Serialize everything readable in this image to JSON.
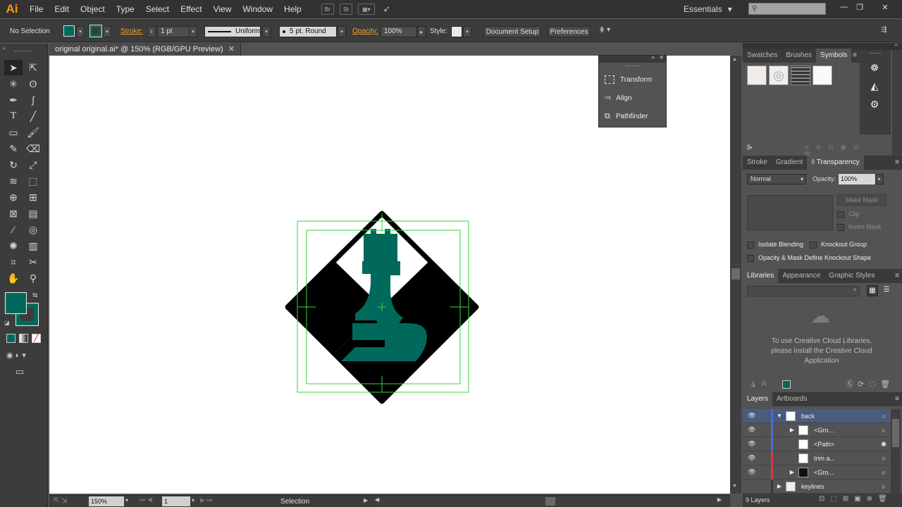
{
  "app": {
    "logo": "Ai",
    "brand_color": "#ff9a00"
  },
  "menu": [
    "File",
    "Edit",
    "Object",
    "Type",
    "Select",
    "Effect",
    "View",
    "Window",
    "Help"
  ],
  "menubar_extras": {
    "bridge": "Br",
    "stock": "St"
  },
  "workspace": "Essentials",
  "search": {
    "placeholder": ""
  },
  "control_bar": {
    "selection": "No Selection",
    "stroke_label": "Stroke:",
    "stroke_weight": "1 pt",
    "profile": "Uniform",
    "brush": "5 pt. Round",
    "opacity_label": "Opacity:",
    "opacity": "100%",
    "style_label": "Style:",
    "doc_setup": "Document Setup",
    "preferences": "Preferences"
  },
  "document": {
    "tab_title": "original original.ai* @ 150% (RGB/GPU Preview)",
    "zoom": "150%",
    "artboard": "1",
    "status": "Selection",
    "fill_color": "#00695c"
  },
  "float_panel": [
    {
      "label": "Transform",
      "icon": "transform-icon"
    },
    {
      "label": "Align",
      "icon": "align-icon"
    },
    {
      "label": "Pathfinder",
      "icon": "pathfinder-icon"
    }
  ],
  "symbols_panel": {
    "tabs": [
      "Swatches",
      "Brushes",
      "Symbols"
    ],
    "active": "Symbols"
  },
  "transparency_panel": {
    "tabs": [
      "Stroke",
      "Gradient",
      "Transparency"
    ],
    "blend_mode": "Normal",
    "opacity_label": "Opacity:",
    "opacity": "100%",
    "make_mask": "Make Mask",
    "clip": "Clip",
    "invert_mask": "Invert Mask",
    "isolate": "Isolate Blending",
    "knockout": "Knockout Group",
    "opacity_mask": "Opacity & Mask Define Knockout Shape"
  },
  "libraries_panel": {
    "tabs": [
      "Libraries",
      "Appearance",
      "Graphic Styles"
    ],
    "message": "To use Creative Cloud Libraries, please install the Creative Cloud Application"
  },
  "layers_panel": {
    "tabs": [
      "Layers",
      "Artboards"
    ],
    "rows": [
      {
        "name": "back",
        "selected": true,
        "color": "#4a6bd6"
      },
      {
        "name": "<Gro...",
        "selected": false,
        "color": "#4a6bd6"
      },
      {
        "name": "<Path>",
        "selected": false,
        "color": "#4a6bd6"
      },
      {
        "name": "trim a...",
        "selected": false,
        "color": "#d63a3a"
      },
      {
        "name": "<Gro...",
        "selected": false,
        "color": "#d63a3a"
      },
      {
        "name": "keylines",
        "selected": false,
        "color": "#3a3a3a"
      }
    ],
    "count": "9 Layers"
  }
}
